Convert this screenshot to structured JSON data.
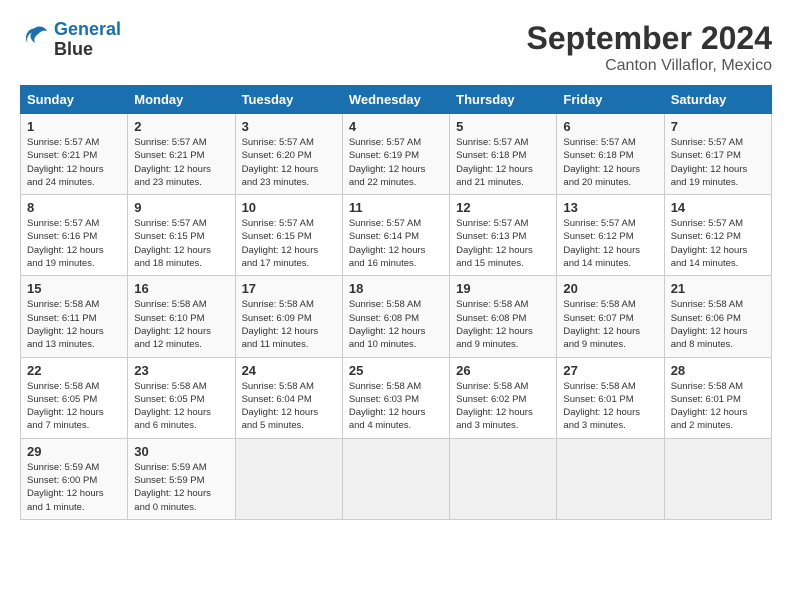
{
  "logo": {
    "line1": "General",
    "line2": "Blue"
  },
  "title": "September 2024",
  "subtitle": "Canton Villaflor, Mexico",
  "headers": [
    "Sunday",
    "Monday",
    "Tuesday",
    "Wednesday",
    "Thursday",
    "Friday",
    "Saturday"
  ],
  "weeks": [
    [
      {
        "day": "1",
        "info": "Sunrise: 5:57 AM\nSunset: 6:21 PM\nDaylight: 12 hours\nand 24 minutes."
      },
      {
        "day": "2",
        "info": "Sunrise: 5:57 AM\nSunset: 6:21 PM\nDaylight: 12 hours\nand 23 minutes."
      },
      {
        "day": "3",
        "info": "Sunrise: 5:57 AM\nSunset: 6:20 PM\nDaylight: 12 hours\nand 23 minutes."
      },
      {
        "day": "4",
        "info": "Sunrise: 5:57 AM\nSunset: 6:19 PM\nDaylight: 12 hours\nand 22 minutes."
      },
      {
        "day": "5",
        "info": "Sunrise: 5:57 AM\nSunset: 6:18 PM\nDaylight: 12 hours\nand 21 minutes."
      },
      {
        "day": "6",
        "info": "Sunrise: 5:57 AM\nSunset: 6:18 PM\nDaylight: 12 hours\nand 20 minutes."
      },
      {
        "day": "7",
        "info": "Sunrise: 5:57 AM\nSunset: 6:17 PM\nDaylight: 12 hours\nand 19 minutes."
      }
    ],
    [
      {
        "day": "8",
        "info": "Sunrise: 5:57 AM\nSunset: 6:16 PM\nDaylight: 12 hours\nand 19 minutes."
      },
      {
        "day": "9",
        "info": "Sunrise: 5:57 AM\nSunset: 6:15 PM\nDaylight: 12 hours\nand 18 minutes."
      },
      {
        "day": "10",
        "info": "Sunrise: 5:57 AM\nSunset: 6:15 PM\nDaylight: 12 hours\nand 17 minutes."
      },
      {
        "day": "11",
        "info": "Sunrise: 5:57 AM\nSunset: 6:14 PM\nDaylight: 12 hours\nand 16 minutes."
      },
      {
        "day": "12",
        "info": "Sunrise: 5:57 AM\nSunset: 6:13 PM\nDaylight: 12 hours\nand 15 minutes."
      },
      {
        "day": "13",
        "info": "Sunrise: 5:57 AM\nSunset: 6:12 PM\nDaylight: 12 hours\nand 14 minutes."
      },
      {
        "day": "14",
        "info": "Sunrise: 5:57 AM\nSunset: 6:12 PM\nDaylight: 12 hours\nand 14 minutes."
      }
    ],
    [
      {
        "day": "15",
        "info": "Sunrise: 5:58 AM\nSunset: 6:11 PM\nDaylight: 12 hours\nand 13 minutes."
      },
      {
        "day": "16",
        "info": "Sunrise: 5:58 AM\nSunset: 6:10 PM\nDaylight: 12 hours\nand 12 minutes."
      },
      {
        "day": "17",
        "info": "Sunrise: 5:58 AM\nSunset: 6:09 PM\nDaylight: 12 hours\nand 11 minutes."
      },
      {
        "day": "18",
        "info": "Sunrise: 5:58 AM\nSunset: 6:08 PM\nDaylight: 12 hours\nand 10 minutes."
      },
      {
        "day": "19",
        "info": "Sunrise: 5:58 AM\nSunset: 6:08 PM\nDaylight: 12 hours\nand 9 minutes."
      },
      {
        "day": "20",
        "info": "Sunrise: 5:58 AM\nSunset: 6:07 PM\nDaylight: 12 hours\nand 9 minutes."
      },
      {
        "day": "21",
        "info": "Sunrise: 5:58 AM\nSunset: 6:06 PM\nDaylight: 12 hours\nand 8 minutes."
      }
    ],
    [
      {
        "day": "22",
        "info": "Sunrise: 5:58 AM\nSunset: 6:05 PM\nDaylight: 12 hours\nand 7 minutes."
      },
      {
        "day": "23",
        "info": "Sunrise: 5:58 AM\nSunset: 6:05 PM\nDaylight: 12 hours\nand 6 minutes."
      },
      {
        "day": "24",
        "info": "Sunrise: 5:58 AM\nSunset: 6:04 PM\nDaylight: 12 hours\nand 5 minutes."
      },
      {
        "day": "25",
        "info": "Sunrise: 5:58 AM\nSunset: 6:03 PM\nDaylight: 12 hours\nand 4 minutes."
      },
      {
        "day": "26",
        "info": "Sunrise: 5:58 AM\nSunset: 6:02 PM\nDaylight: 12 hours\nand 3 minutes."
      },
      {
        "day": "27",
        "info": "Sunrise: 5:58 AM\nSunset: 6:01 PM\nDaylight: 12 hours\nand 3 minutes."
      },
      {
        "day": "28",
        "info": "Sunrise: 5:58 AM\nSunset: 6:01 PM\nDaylight: 12 hours\nand 2 minutes."
      }
    ],
    [
      {
        "day": "29",
        "info": "Sunrise: 5:59 AM\nSunset: 6:00 PM\nDaylight: 12 hours\nand 1 minute."
      },
      {
        "day": "30",
        "info": "Sunrise: 5:59 AM\nSunset: 5:59 PM\nDaylight: 12 hours\nand 0 minutes."
      },
      {
        "day": "",
        "info": ""
      },
      {
        "day": "",
        "info": ""
      },
      {
        "day": "",
        "info": ""
      },
      {
        "day": "",
        "info": ""
      },
      {
        "day": "",
        "info": ""
      }
    ]
  ]
}
